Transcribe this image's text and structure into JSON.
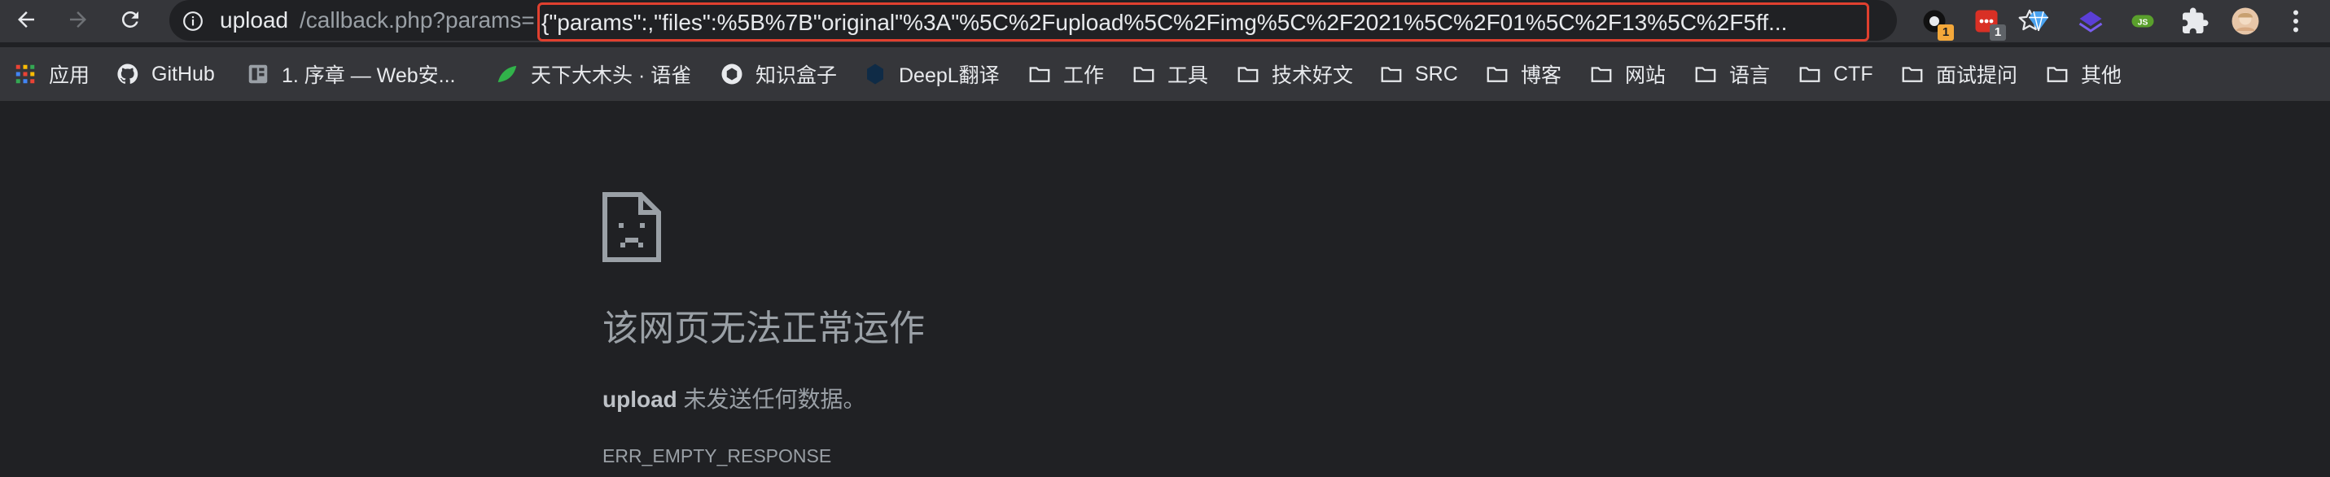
{
  "toolbar": {
    "back_icon": "arrow-left-icon",
    "forward_icon": "arrow-right-icon",
    "reload_icon": "reload-icon",
    "address": {
      "info_icon": "info-icon",
      "host": "upload",
      "path": "/callback.php?params=",
      "params": "{\"params\":,\"files\":%5B%7B\"original\"%3A\"%5C%2Fupload%5C%2Fimg%5C%2F2021%5C%2F01%5C%2F13%5C%2F5ff...",
      "star_icon": "star-icon"
    },
    "extensions": [
      {
        "icon": "circle-ext-icon",
        "badge": "1",
        "badge_color": "#f4a83a"
      },
      {
        "icon": "red-ext-icon",
        "badge": "1",
        "badge_color": "#5f6368"
      },
      {
        "icon": "diamond-ext-icon"
      },
      {
        "icon": "layers-ext-icon"
      },
      {
        "icon": "js-ext-icon",
        "badge": "JS"
      },
      {
        "icon": "puzzle-icon"
      },
      {
        "icon": "avatar-icon"
      },
      {
        "icon": "more-vert-icon"
      }
    ]
  },
  "bookmarks": [
    {
      "label": "应用",
      "icon": "apps-grid-icon"
    },
    {
      "label": "GitHub",
      "icon": "github-icon"
    },
    {
      "label": "1. 序章 — Web安...",
      "icon": "book-icon"
    },
    {
      "label": "天下大木头 · 语雀",
      "icon": "leaf-icon"
    },
    {
      "label": "知识盒子",
      "icon": "box-icon"
    },
    {
      "label": "DeepL翻译",
      "icon": "deepl-icon"
    },
    {
      "label": "工作",
      "icon": "folder-icon"
    },
    {
      "label": "工具",
      "icon": "folder-icon"
    },
    {
      "label": "技术好文",
      "icon": "folder-icon"
    },
    {
      "label": "SRC",
      "icon": "folder-icon"
    },
    {
      "label": "博客",
      "icon": "folder-icon"
    },
    {
      "label": "网站",
      "icon": "folder-icon"
    },
    {
      "label": "语言",
      "icon": "folder-icon"
    },
    {
      "label": "CTF",
      "icon": "folder-icon"
    },
    {
      "label": "面试提问",
      "icon": "folder-icon"
    },
    {
      "label": "其他",
      "icon": "folder-icon"
    }
  ],
  "error": {
    "icon": "sad-page-icon",
    "title": "该网页无法正常运作",
    "host": "upload",
    "message": " 未发送任何数据。",
    "code": "ERR_EMPTY_RESPONSE"
  },
  "colors": {
    "toolbar_bg": "#35363a",
    "page_bg": "#202124",
    "highlight_border": "#e0402f"
  }
}
